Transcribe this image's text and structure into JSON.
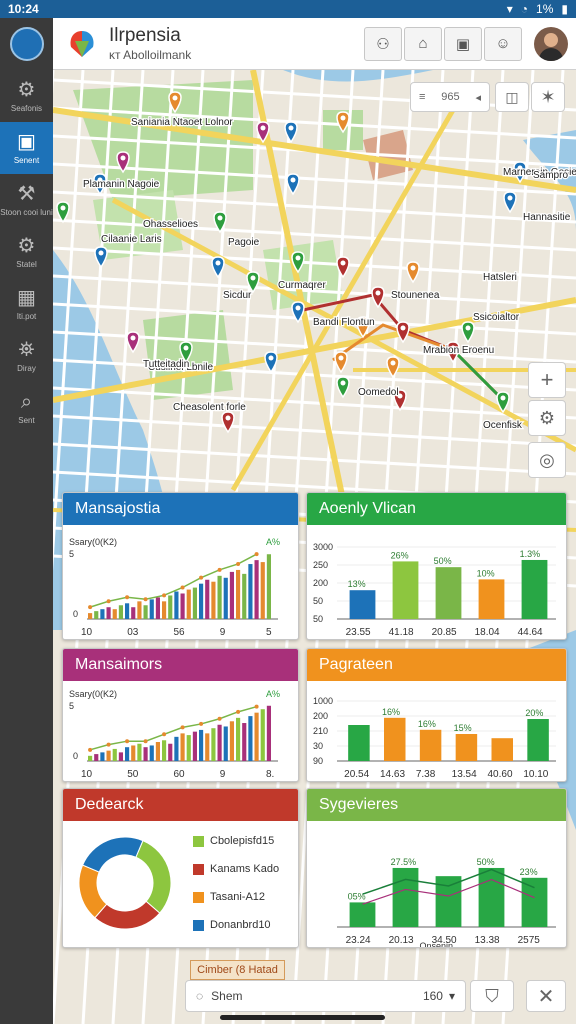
{
  "status": {
    "time": "10:24",
    "battery": "1%"
  },
  "header": {
    "title": "Ilrpensia",
    "subtitle": "ᴋᴛ Abolloilmank",
    "buttons": [
      "person-pin-icon",
      "home-icon",
      "building-icon",
      "user-icon"
    ]
  },
  "sidebar": {
    "items": [
      {
        "label": "Seafonis",
        "icon": "gear-icon"
      },
      {
        "label": "Senent",
        "icon": "map-icon",
        "active": true
      },
      {
        "label": "Stoon cooi luni",
        "icon": "wrench-icon"
      },
      {
        "label": "Statel",
        "icon": "gear-icon"
      },
      {
        "label": "Iti.pot",
        "icon": "grid-icon"
      },
      {
        "label": "Diray",
        "icon": "compass-icon"
      },
      {
        "label": "Sent",
        "icon": "search-icon"
      }
    ]
  },
  "map": {
    "labels": [
      "Saniania Ntaoet Lolnor",
      "Plamanin Nagoie",
      "Cilaanie Laris",
      "Ohasselioes",
      "Pagoie",
      "Curmaqrer",
      "Sicdur",
      "Stounenea",
      "Cusiinei Lbnile",
      "Cheasolent forle",
      "Oomedol",
      "Ocenfisk",
      "Marneroin Gosie",
      "Sampro",
      "Hatsleri",
      "Mrabion Eroenu",
      "Bandi Flontun",
      "Tutteitadin",
      "Ssicoialtor",
      "Hannasitie"
    ],
    "search_count": "965",
    "search_icon": "menu-icon"
  },
  "panels": {
    "p1": {
      "title": "Mansajostia",
      "color": "#1d72b8"
    },
    "p2": {
      "title": "Aoenly Vlican",
      "color": "#28a745"
    },
    "p3": {
      "title": "Mansaimors",
      "color": "#a8307a"
    },
    "p4": {
      "title": "Pagrateen",
      "color": "#f0921e"
    },
    "p5": {
      "title": "Dedearck",
      "color": "#c0392b"
    },
    "p6": {
      "title": "Sygevieres",
      "color": "#7ab648"
    }
  },
  "chart_data": [
    {
      "type": "bar",
      "title": "Mansajostia",
      "ylabel": "Ssary(0(K2)",
      "y_ticks": [
        "5",
        "0"
      ],
      "x_ticks": [
        "10",
        "03",
        "56",
        "9",
        "5"
      ],
      "annotation_top": "A%",
      "series": [
        {
          "values": [
            3,
            4,
            5,
            6,
            5,
            7,
            8,
            6,
            9,
            7,
            10,
            11,
            9,
            12,
            14,
            13,
            15,
            16,
            18,
            20,
            19,
            22,
            21,
            24,
            25,
            23,
            28,
            30,
            29,
            33
          ]
        }
      ],
      "colors": [
        "#e58a2e",
        "#7ab648",
        "#1d72b8",
        "#a8307a"
      ]
    },
    {
      "type": "bar",
      "title": "Aoenly Vlican",
      "categories": [
        "23.55",
        "41.18",
        "20.85",
        "18.04",
        "44.64"
      ],
      "y_ticks": [
        "3000",
        "250",
        "200",
        "50",
        "50"
      ],
      "values": [
        40,
        80,
        72,
        55,
        82
      ],
      "labels": [
        "13%",
        "26%",
        "50%",
        "10%",
        "1.3%"
      ],
      "colors": [
        "#1d72b8",
        "#8dc63f",
        "#7ab648",
        "#f0921e",
        "#28a745"
      ]
    },
    {
      "type": "bar",
      "title": "Mansaimors",
      "ylabel": "Ssary(0(K2)",
      "y_ticks": [
        "5",
        "0"
      ],
      "x_ticks": [
        "10",
        "50",
        "60",
        "9",
        "8."
      ],
      "annotation_top": "A%",
      "series": [
        {
          "values": [
            3,
            4,
            5,
            6,
            7,
            5,
            8,
            9,
            10,
            8,
            9,
            11,
            12,
            10,
            14,
            16,
            15,
            17,
            18,
            16,
            19,
            21,
            20,
            23,
            25,
            22,
            26,
            28,
            30,
            32
          ]
        }
      ],
      "colors": [
        "#8dc63f",
        "#a8307a",
        "#1d72b8",
        "#e58a2e"
      ]
    },
    {
      "type": "bar",
      "title": "Pagrateen",
      "categories": [
        "20.54",
        "14.63",
        "7.38",
        "13.54",
        "40.60",
        "10.10"
      ],
      "y_ticks": [
        "1000",
        "200",
        "210",
        "30",
        "90"
      ],
      "values": [
        60,
        72,
        52,
        45,
        38,
        70
      ],
      "labels": [
        "",
        "16%",
        "16%",
        "15%",
        "",
        "20%"
      ],
      "colors": [
        "#28a745",
        "#f0921e",
        "#f0921e",
        "#f0921e",
        "#f0921e",
        "#28a745"
      ]
    },
    {
      "type": "pie",
      "title": "Dedearck",
      "slices": [
        {
          "label": "Cbolepisfd15",
          "value": 30,
          "color": "#8dc63f"
        },
        {
          "label": "Kanams Kado",
          "value": 25,
          "color": "#c0392b"
        },
        {
          "label": "Tasani-A12",
          "value": 20,
          "color": "#f0921e"
        },
        {
          "label": "Donanbrd10",
          "value": 25,
          "color": "#1d72b8"
        }
      ]
    },
    {
      "type": "bar",
      "title": "Sygevieres",
      "categories": [
        "23.24",
        "20.13",
        "34.50",
        "13.38",
        "2575"
      ],
      "xlabel": "Onsenin",
      "values": [
        30,
        72,
        62,
        72,
        60
      ],
      "labels": [
        "05%",
        "27.5%",
        "",
        "50%",
        "23%"
      ],
      "colors": [
        "#28a745",
        "#28a745",
        "#28a745",
        "#28a745",
        "#28a745"
      ],
      "line_values": [
        40,
        58,
        50,
        70,
        48
      ]
    }
  ],
  "bottombar": {
    "label": "Shem",
    "value": "160",
    "chip": "Cimber (8 Hatad"
  }
}
